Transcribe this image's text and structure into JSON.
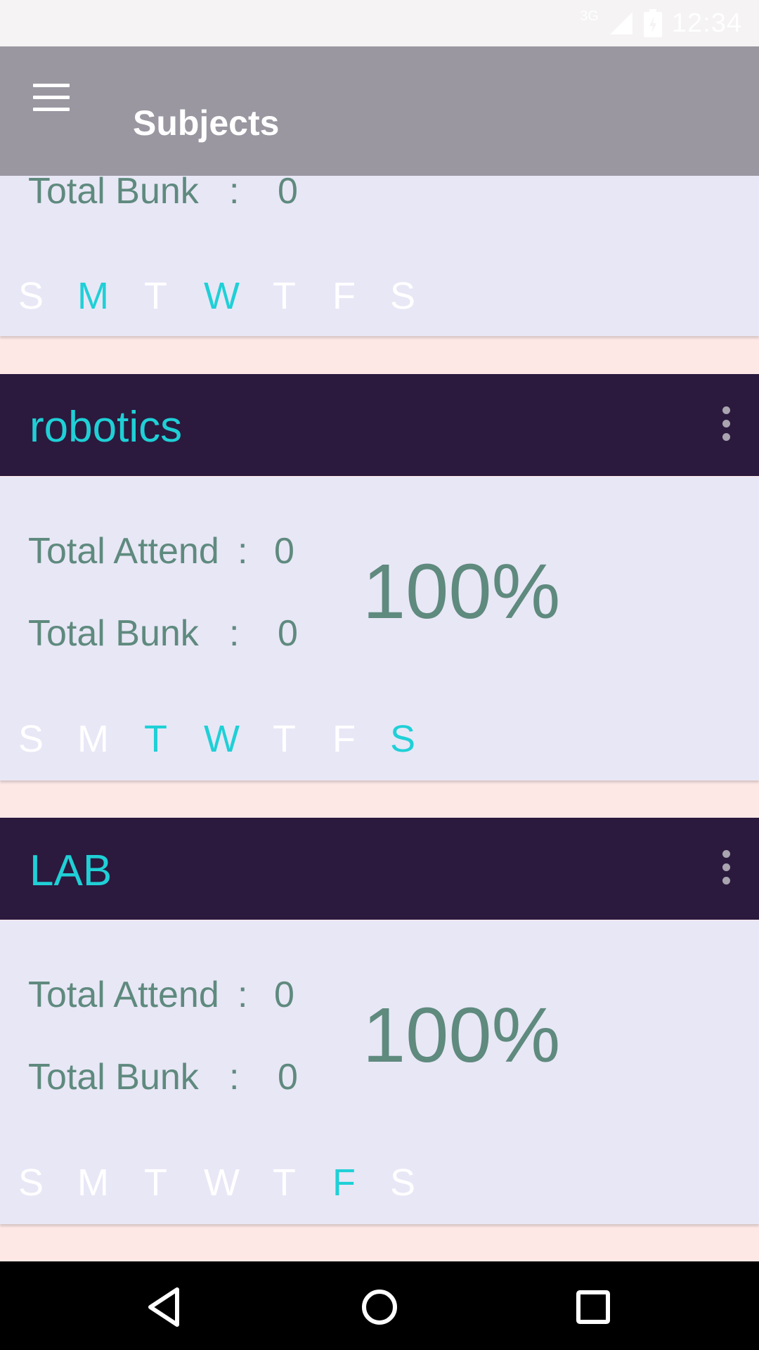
{
  "status_bar": {
    "network": "3G",
    "time": "12:34"
  },
  "toolbar": {
    "title": "Subjects"
  },
  "labels": {
    "total_attend": "Total Attend",
    "total_bunk": "Total Bunk",
    "colon": ":"
  },
  "days": [
    "S",
    "M",
    "T",
    "W",
    "T",
    "F",
    "S"
  ],
  "cards": [
    {
      "name": "",
      "total_bunk": "0",
      "active_days": [
        1,
        3
      ]
    },
    {
      "name": "robotics",
      "total_attend": "0",
      "total_bunk": "0",
      "percent": "100%",
      "active_days": [
        2,
        3,
        6
      ]
    },
    {
      "name": "LAB",
      "total_attend": "0",
      "total_bunk": "0",
      "percent": "100%",
      "active_days": [
        5
      ]
    }
  ],
  "colors": {
    "accent": "#1fd0d6",
    "header_bg": "#2b1a3e",
    "card_bg": "#e8e7f6",
    "page_bg": "#fde8e6",
    "toolbar_bg": "#9a97a1",
    "stat_text": "#5f8a7e"
  },
  "nav": {
    "back_icon": "back-icon",
    "home_icon": "home-icon",
    "recents_icon": "recents-icon"
  }
}
